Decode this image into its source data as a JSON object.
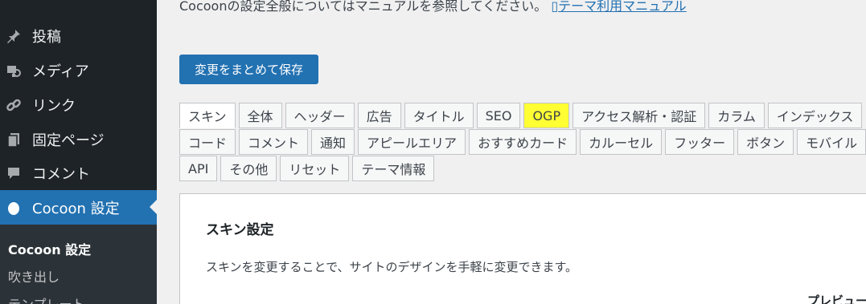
{
  "sidebar": {
    "items": [
      {
        "label": "投稿",
        "icon": "pin-icon"
      },
      {
        "label": "メディア",
        "icon": "media-icon"
      },
      {
        "label": "リンク",
        "icon": "link-icon"
      },
      {
        "label": "固定ページ",
        "icon": "page-icon"
      },
      {
        "label": "コメント",
        "icon": "comment-icon"
      },
      {
        "label": "Cocoon 設定",
        "icon": "cocoon-icon"
      }
    ],
    "submenu": [
      "Cocoon 設定",
      "吹き出し",
      "テンプレート"
    ]
  },
  "intro": {
    "text": "Cocoonの設定全般についてはマニュアルを参照してください。",
    "link": "テーマ利用マニュアル"
  },
  "save_button": "変更をまとめて保存",
  "tabs": {
    "row1": [
      "スキン",
      "全体",
      "ヘッダー",
      "広告",
      "タイトル",
      "SEO",
      "OGP",
      "アクセス解析・認証",
      "カラム",
      "インデックス"
    ],
    "row2": [
      "コード",
      "コメント",
      "通知",
      "アピールエリア",
      "おすすめカード",
      "カルーセル",
      "フッター",
      "ボタン",
      "モバイル"
    ],
    "row3": [
      "API",
      "その他",
      "リセット",
      "テーマ情報"
    ]
  },
  "panel": {
    "title": "スキン設定",
    "description": "スキンを変更することで、サイトのデザインを手軽に変更できます。",
    "preview_label": "プレビュー"
  },
  "colors": {
    "sidebar_bg": "#1d2327",
    "active_bg": "#2271b1",
    "highlight": "#ffff33"
  }
}
